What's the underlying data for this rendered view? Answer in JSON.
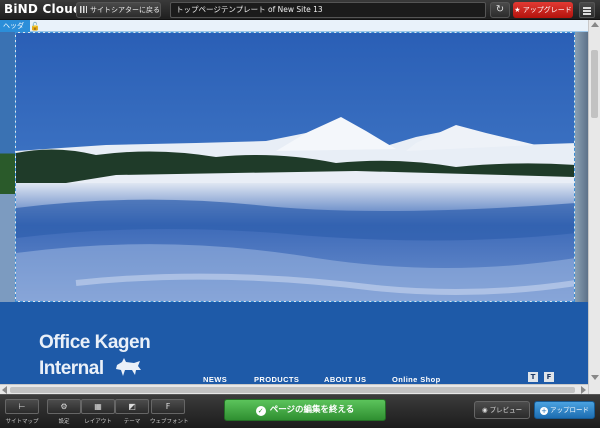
{
  "app": {
    "title": "BiND Cloud"
  },
  "topbar": {
    "back_label": "サイトシアターに戻る",
    "url_value": "トップページテンプレート of New Site 13",
    "reload_icon": "reload-icon",
    "upgrade_label": "アップグレード",
    "upgrade_color": "#c81d16"
  },
  "canvas": {
    "header_tag": "ヘッダ",
    "site": {
      "title_line1": "Office Kagen",
      "title_line2": "Internal",
      "nav": [
        "NEWS",
        "PRODUCTS",
        "ABOUT US",
        "Online Shop"
      ],
      "social": [
        "T",
        "F"
      ],
      "nav_bg": "#1e5aa8"
    }
  },
  "bottombar": {
    "tools": [
      {
        "label": "サイトマップ",
        "icon": "sitemap-icon"
      },
      {
        "label": "設定",
        "icon": "gear-icon"
      },
      {
        "label": "レイアウト",
        "icon": "layout-icon"
      },
      {
        "label": "テーマ",
        "icon": "theme-icon"
      },
      {
        "label": "ウェブフォント",
        "icon": "webfont-icon"
      }
    ],
    "finish_label": "ページの編集を終える",
    "finish_color": "#3aa63c",
    "preview_label": "プレビュー",
    "upload_label": "アップロード",
    "upload_color": "#2a86cc"
  }
}
